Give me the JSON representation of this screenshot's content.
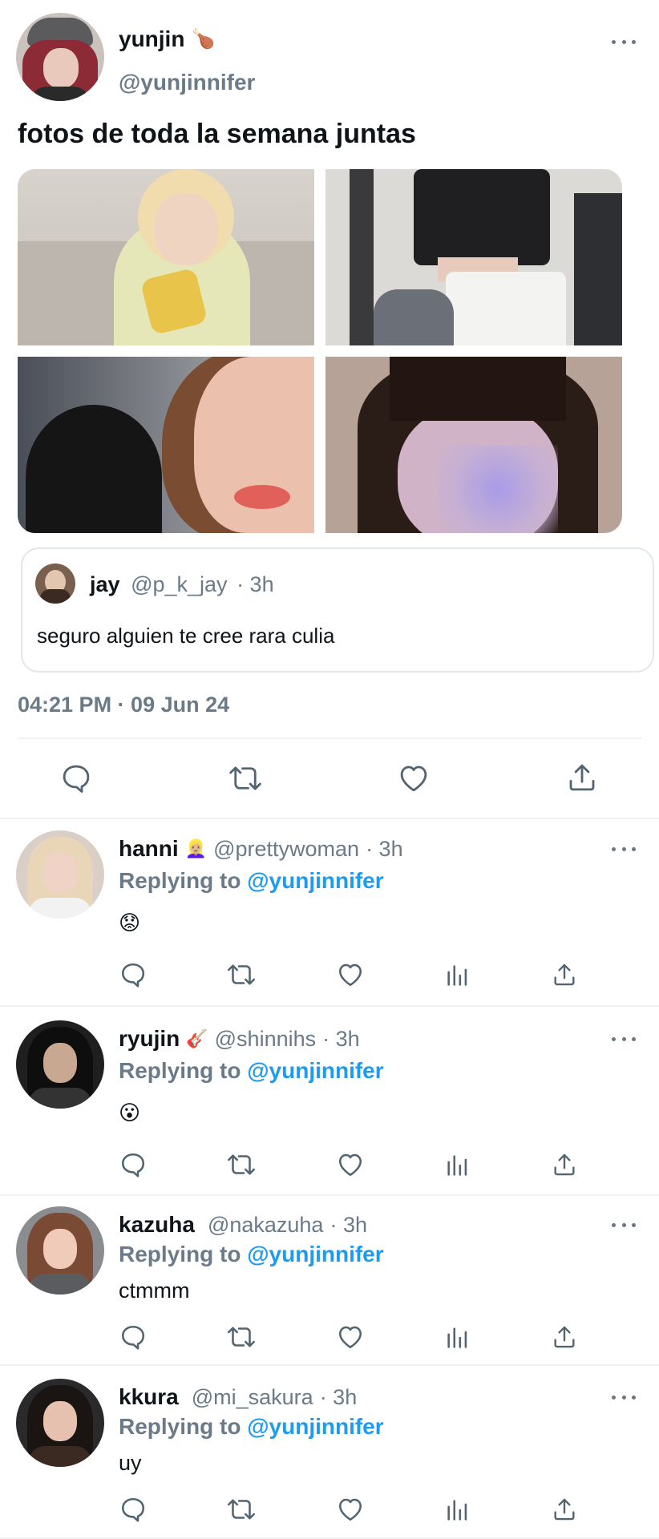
{
  "main_tweet": {
    "display_name": "yunjin",
    "name_emoji": "🍗",
    "handle": "@yunjinnifer",
    "text": "fotos de toda la semana juntas",
    "timestamp": "04:21 PM · 09 Jun 24"
  },
  "quoted_tweet": {
    "display_name": "jay",
    "handle": "@p_k_jay",
    "time": "· 3h",
    "text": "seguro alguien te cree rara culia"
  },
  "replies": [
    {
      "display_name": "hanni",
      "name_emoji": "👱🏼‍♀️",
      "handle": "@prettywoman",
      "time": "· 3h",
      "replying_label": "Replying to",
      "replying_to": "@yunjinnifer",
      "text": "😟"
    },
    {
      "display_name": "ryujin",
      "name_emoji": "🎸",
      "handle": "@shinnihs",
      "time": "· 3h",
      "replying_label": "Replying to",
      "replying_to": "@yunjinnifer",
      "text": "😮"
    },
    {
      "display_name": "kazuha",
      "name_emoji": "",
      "handle": "@nakazuha",
      "time": "· 3h",
      "replying_label": "Replying to",
      "replying_to": "@yunjinnifer",
      "text": "ctmmm"
    },
    {
      "display_name": "kkura",
      "name_emoji": "",
      "handle": "@mi_sakura",
      "time": "· 3h",
      "replying_label": "Replying to",
      "replying_to": "@yunjinnifer",
      "text": "uy"
    }
  ],
  "icons": {
    "more": "more-horizontal-icon",
    "reply": "reply-bubble-icon",
    "retweet": "retweet-icon",
    "like": "heart-icon",
    "views": "bar-chart-icon",
    "share": "share-upload-icon"
  },
  "colors": {
    "accent": "#1d9bf0",
    "muted": "#536471",
    "handle": "#6b7a88",
    "icon": "#536471",
    "divider": "#eff3f4"
  }
}
